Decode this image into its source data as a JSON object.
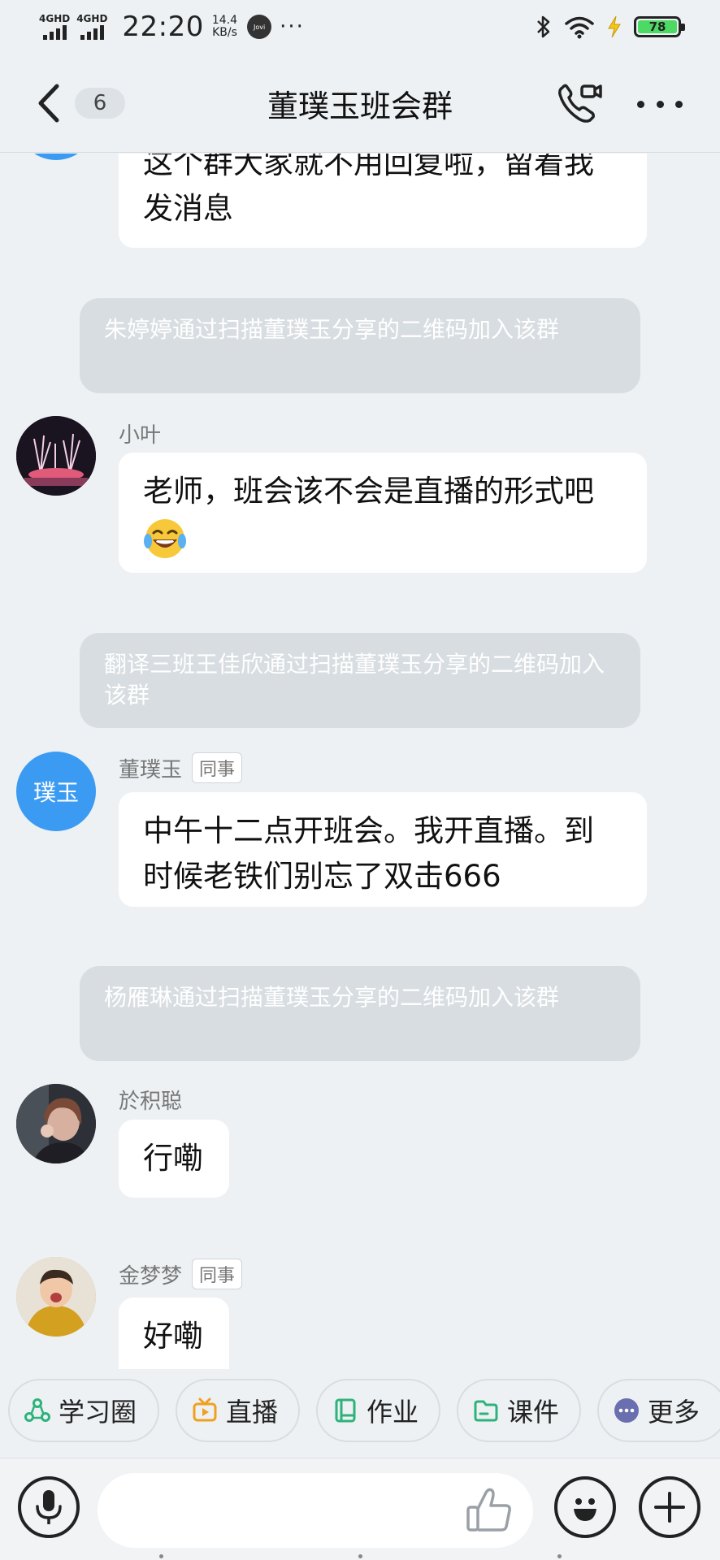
{
  "status_bar": {
    "signal1": "4GHD",
    "signal2": "4GHD",
    "time": "22:20",
    "speed_value": "14.4",
    "speed_unit": "KB/s",
    "jovi": "Jovi",
    "more": "···",
    "battery": "78"
  },
  "header": {
    "unread_count": "6",
    "title": "董璞玉班会群"
  },
  "messages": [
    {
      "type": "text",
      "sender": "",
      "text": "这个群大家就不用回复啦，留着我发消息"
    },
    {
      "type": "system",
      "text": "朱婷婷通过扫描董璞玉分享的二维码加入该群"
    },
    {
      "type": "text",
      "sender": "小叶",
      "text": "老师，班会该不会是直播的形式吧",
      "emoji": "laughing-with-tears"
    },
    {
      "type": "system",
      "text": "翻译三班王佳欣通过扫描董璞玉分享的二维码加入该群"
    },
    {
      "type": "text",
      "sender": "董璞玉",
      "tag": "同事",
      "avatar_text": "璞玉",
      "text": "中午十二点开班会。我开直播。到时候老铁们别忘了双击666"
    },
    {
      "type": "system",
      "text": "杨雁琳通过扫描董璞玉分享的二维码加入该群"
    },
    {
      "type": "text",
      "sender": "於积聪",
      "text": "行嘞"
    },
    {
      "type": "text",
      "sender": "金梦梦",
      "tag": "同事",
      "text": "好嘞"
    }
  ],
  "quick_actions": [
    {
      "label": "学习圈",
      "icon": "circle-share-icon",
      "color": "#2db37a"
    },
    {
      "label": "直播",
      "icon": "live-tv-icon",
      "color": "#f0a020"
    },
    {
      "label": "作业",
      "icon": "book-icon",
      "color": "#2db37a"
    },
    {
      "label": "课件",
      "icon": "folder-icon",
      "color": "#2db37a"
    },
    {
      "label": "更多",
      "icon": "more-dots-icon",
      "color": "#6a6fb0"
    }
  ],
  "input": {
    "placeholder": ""
  }
}
